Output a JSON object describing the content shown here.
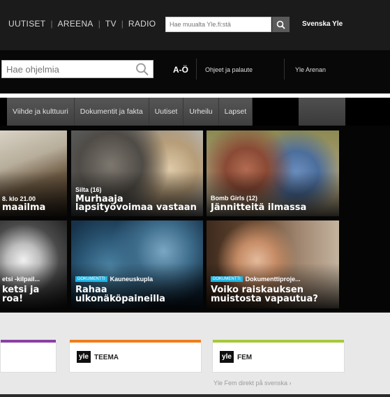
{
  "top_nav": {
    "items": [
      "UUTISET",
      "AREENA",
      "TV",
      "RADIO"
    ],
    "search_placeholder": "Hae muualta Yle.fi:stä",
    "svenska_label": "Svenska Yle"
  },
  "program_bar": {
    "search_placeholder": "Hae ohjelmia",
    "ao_label": "A-Ö",
    "feedback_label": "Ohjeet ja palaute",
    "arenan_label": "Yle Arenan"
  },
  "categories": [
    "Viihde ja kulttuuri",
    "Dokumentit ja fakta",
    "Uutiset",
    "Urheilu",
    "Lapset"
  ],
  "tiles": [
    {
      "tagline": "8. klo 21.00",
      "title_lines": [
        "maailma"
      ]
    },
    {
      "tagline": "Silta (16)",
      "title_lines": [
        "Murhaaja",
        "lapsityövoimaa vastaan"
      ]
    },
    {
      "tagline": "Bomb Girls (12)",
      "title_lines": [
        "Jännitteitä ilmassa"
      ]
    },
    {
      "tagline": "etsi -kilpail...",
      "title_lines": [
        "ketsi ja",
        "roa!"
      ]
    },
    {
      "badge": "DOKUMENTTI",
      "tagline": "Kauneuskupla",
      "title_lines": [
        "Rahaa",
        "ulkonäköpaineilla"
      ]
    },
    {
      "badge": "DOKUMENTTI",
      "tagline": "Dokumenttiproje...",
      "title_lines": [
        "Voiko raiskauksen",
        "muistosta vapautua?"
      ]
    }
  ],
  "channels": [
    {
      "logo": "yle",
      "name": "",
      "accent": "#8a3fa6"
    },
    {
      "logo": "yle",
      "name": "TEEMA",
      "accent": "#f07d1b"
    },
    {
      "logo": "yle",
      "name": "FEM",
      "accent": "#a6c83a"
    }
  ],
  "fem_link": "Yle Fem direkt på svenska ›",
  "icons": {
    "top_search": "search-icon",
    "program_search": "search-icon"
  }
}
